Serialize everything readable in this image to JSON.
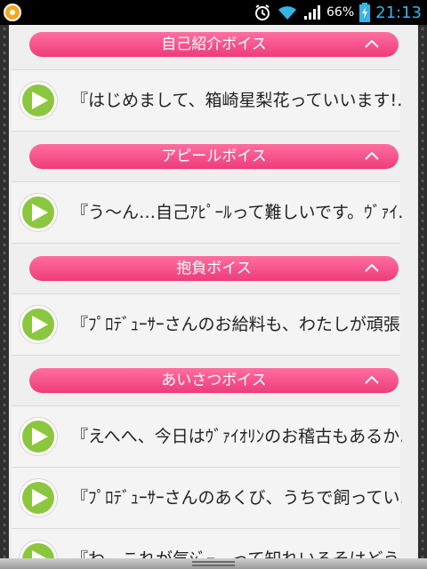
{
  "status_bar": {
    "battery_percent": "66%",
    "time": "21:13",
    "icons": [
      "app-notification-icon",
      "alarm-icon",
      "wifi-icon",
      "signal-icon",
      "battery-charging-icon"
    ],
    "time_color": "#37b4e6"
  },
  "sections": [
    {
      "title": "自己紹介ボイス",
      "items": [
        "『はじめまして、箱崎星梨花っていいます!…"
      ]
    },
    {
      "title": "アピールボイス",
      "items": [
        "『う～ん…自己ｱﾋﾟｰﾙって難しいです。ｳﾞｧｲ…"
      ]
    },
    {
      "title": "抱負ボイス",
      "items": [
        "『ﾌﾟﾛﾃﾞｭｰｻｰさんのお給料も、わたしが頑張…"
      ]
    },
    {
      "title": "あいさつボイス",
      "items": [
        "『えへへ、今日はｳﾞｧｲｵﾘﾝのお稽古もあるか…",
        "『ﾌﾟﾛﾃﾞｭｰｻｰさんのあくび、うちで飼ってい…",
        "『わ…これが気ｼﾞｰ…って知れいるそはどう…"
      ]
    }
  ],
  "colors": {
    "header_pink": "#ee3b7a",
    "play_green": "#8cc63f",
    "panel_bg": "#efefef"
  }
}
